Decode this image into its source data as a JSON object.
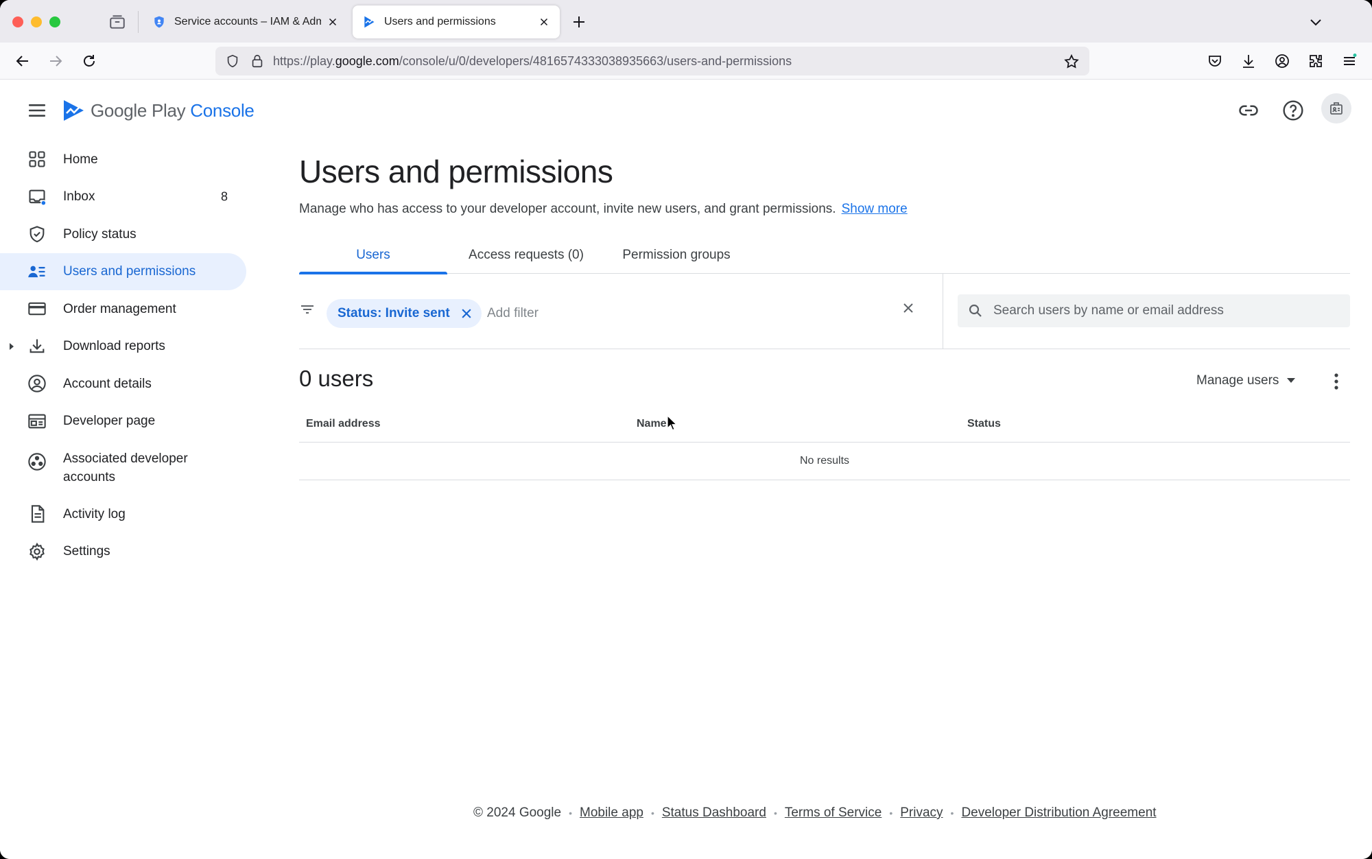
{
  "browser": {
    "tabs": [
      {
        "title": "Service accounts – IAM & Admin",
        "favicon": "shield-icon",
        "active": false
      },
      {
        "title": "Users and permissions",
        "favicon": "play-console-icon",
        "active": true
      }
    ],
    "url_prefix": "https://play.",
    "url_domain": "google.com",
    "url_path": "/console/u/0/developers/4816574333038935663/users-and-permissions"
  },
  "app": {
    "logo_google_play": "Google Play",
    "logo_console": "Console"
  },
  "sidebar": {
    "items": [
      {
        "label": "Home",
        "icon": "dashboard-icon"
      },
      {
        "label": "Inbox",
        "icon": "inbox-icon",
        "badge": "8"
      },
      {
        "label": "Policy status",
        "icon": "shield-check-icon"
      },
      {
        "label": "Users and permissions",
        "icon": "people-list-icon",
        "active": true
      },
      {
        "label": "Order management",
        "icon": "credit-card-icon"
      },
      {
        "label": "Download reports",
        "icon": "download-icon",
        "expandable": true
      },
      {
        "label": "Account details",
        "icon": "account-circle-icon"
      },
      {
        "label": "Developer page",
        "icon": "web-page-icon"
      },
      {
        "label": "Associated developer accounts",
        "icon": "linked-accounts-icon"
      },
      {
        "label": "Activity log",
        "icon": "document-icon"
      },
      {
        "label": "Settings",
        "icon": "gear-icon"
      }
    ]
  },
  "main": {
    "title": "Users and permissions",
    "description": "Manage who has access to your developer account, invite new users, and grant permissions.",
    "show_more": "Show more",
    "tabs": [
      {
        "label": "Users",
        "active": true
      },
      {
        "label": "Access requests (0)",
        "active": false
      },
      {
        "label": "Permission groups",
        "active": false
      }
    ],
    "filter_chip": "Status: Invite sent",
    "add_filter": "Add filter",
    "search_placeholder": "Search users by name or email address",
    "count": "0 users",
    "manage_users": "Manage users",
    "table": {
      "columns": [
        "Email address",
        "Name",
        "Status"
      ],
      "empty_text": "No results"
    }
  },
  "footer": {
    "copyright": "© 2024 Google",
    "links": [
      "Mobile app",
      "Status Dashboard",
      "Terms of Service",
      "Privacy",
      "Developer Distribution Agreement"
    ]
  },
  "colors": {
    "accent": "#1a73e8",
    "active_bg": "#e8f0fe",
    "text": "#202124"
  }
}
